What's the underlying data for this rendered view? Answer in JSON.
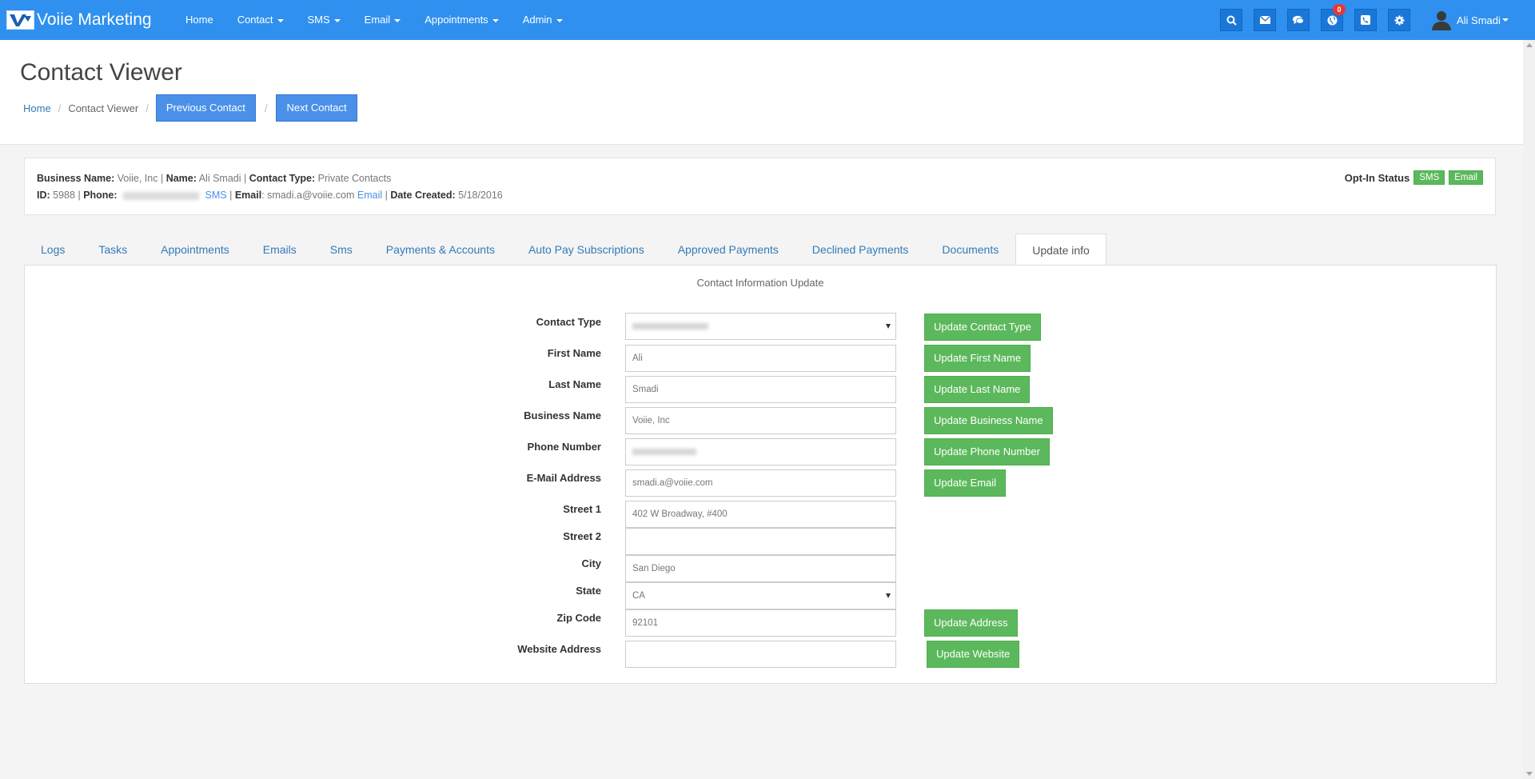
{
  "app": {
    "brand": "Voiie Marketing"
  },
  "nav": {
    "links": [
      {
        "label": "Home",
        "dropdown": false
      },
      {
        "label": "Contact",
        "dropdown": true
      },
      {
        "label": "SMS",
        "dropdown": true
      },
      {
        "label": "Email",
        "dropdown": true
      },
      {
        "label": "Appointments",
        "dropdown": true
      },
      {
        "label": "Admin",
        "dropdown": true
      }
    ],
    "icons": [
      {
        "name": "search-icon"
      },
      {
        "name": "envelope-icon"
      },
      {
        "name": "chat-icon"
      },
      {
        "name": "globe-icon",
        "badge": "0"
      },
      {
        "name": "phone-icon"
      },
      {
        "name": "gear-icon"
      }
    ],
    "user_name": "Ali Smadi"
  },
  "header": {
    "title": "Contact Viewer",
    "breadcrumb_home": "Home",
    "breadcrumb_current": "Contact Viewer",
    "sep": "/",
    "prev_label": "Previous Contact",
    "next_label": "Next Contact"
  },
  "info": {
    "business_name_label": "Business Name:",
    "business_name": "Voiie, Inc",
    "name_label": "Name:",
    "name": "Ali Smadi",
    "contact_type_label": "Contact Type:",
    "contact_type": "Private Contacts",
    "id_label": "ID:",
    "id": "5988",
    "phone_label": "Phone:",
    "sms_link": "SMS",
    "email_label": "Email",
    "email": "smadi.a@voiie.com",
    "email_link": "Email",
    "date_label": "Date Created:",
    "date": "5/18/2016",
    "optin_label": "Opt-In Status",
    "optin_sms": "SMS",
    "optin_email": "Email",
    "pipe": "|"
  },
  "tabs": [
    {
      "label": "Logs",
      "active": false
    },
    {
      "label": "Tasks",
      "active": false
    },
    {
      "label": "Appointments",
      "active": false
    },
    {
      "label": "Emails",
      "active": false
    },
    {
      "label": "Sms",
      "active": false
    },
    {
      "label": "Payments & Accounts",
      "active": false
    },
    {
      "label": "Auto Pay Subscriptions",
      "active": false
    },
    {
      "label": "Approved Payments",
      "active": false
    },
    {
      "label": "Declined Payments",
      "active": false
    },
    {
      "label": "Documents",
      "active": false
    },
    {
      "label": "Update info",
      "active": true
    }
  ],
  "form": {
    "title": "Contact Information Update",
    "fields": [
      {
        "label": "Contact Type",
        "value": "",
        "type": "select",
        "blurred": true,
        "button": "Update Contact Type"
      },
      {
        "label": "First Name",
        "value": "Ali",
        "type": "text",
        "button": "Update First Name"
      },
      {
        "label": "Last Name",
        "value": "Smadi",
        "type": "text",
        "button": "Update Last Name"
      },
      {
        "label": "Business Name",
        "value": "Voiie, Inc",
        "type": "text",
        "button": "Update Business Name"
      },
      {
        "label": "Phone Number",
        "value": "",
        "type": "text",
        "blurred": true,
        "button": "Update Phone Number"
      },
      {
        "label": "E-Mail Address",
        "value": "smadi.a@voiie.com",
        "type": "text",
        "button": "Update Email"
      },
      {
        "label": "Street 1",
        "value": "402 W Broadway, #400",
        "type": "text",
        "button": ""
      },
      {
        "label": "Street 2",
        "value": "",
        "type": "text",
        "button": ""
      },
      {
        "label": "City",
        "value": "San Diego",
        "type": "text",
        "button": ""
      },
      {
        "label": "State",
        "value": "CA",
        "type": "select",
        "button": ""
      },
      {
        "label": "Zip Code",
        "value": "92101",
        "type": "text",
        "button": "Update Address"
      },
      {
        "label": "Website Address",
        "value": "",
        "type": "text",
        "button": "Update Website"
      }
    ]
  }
}
